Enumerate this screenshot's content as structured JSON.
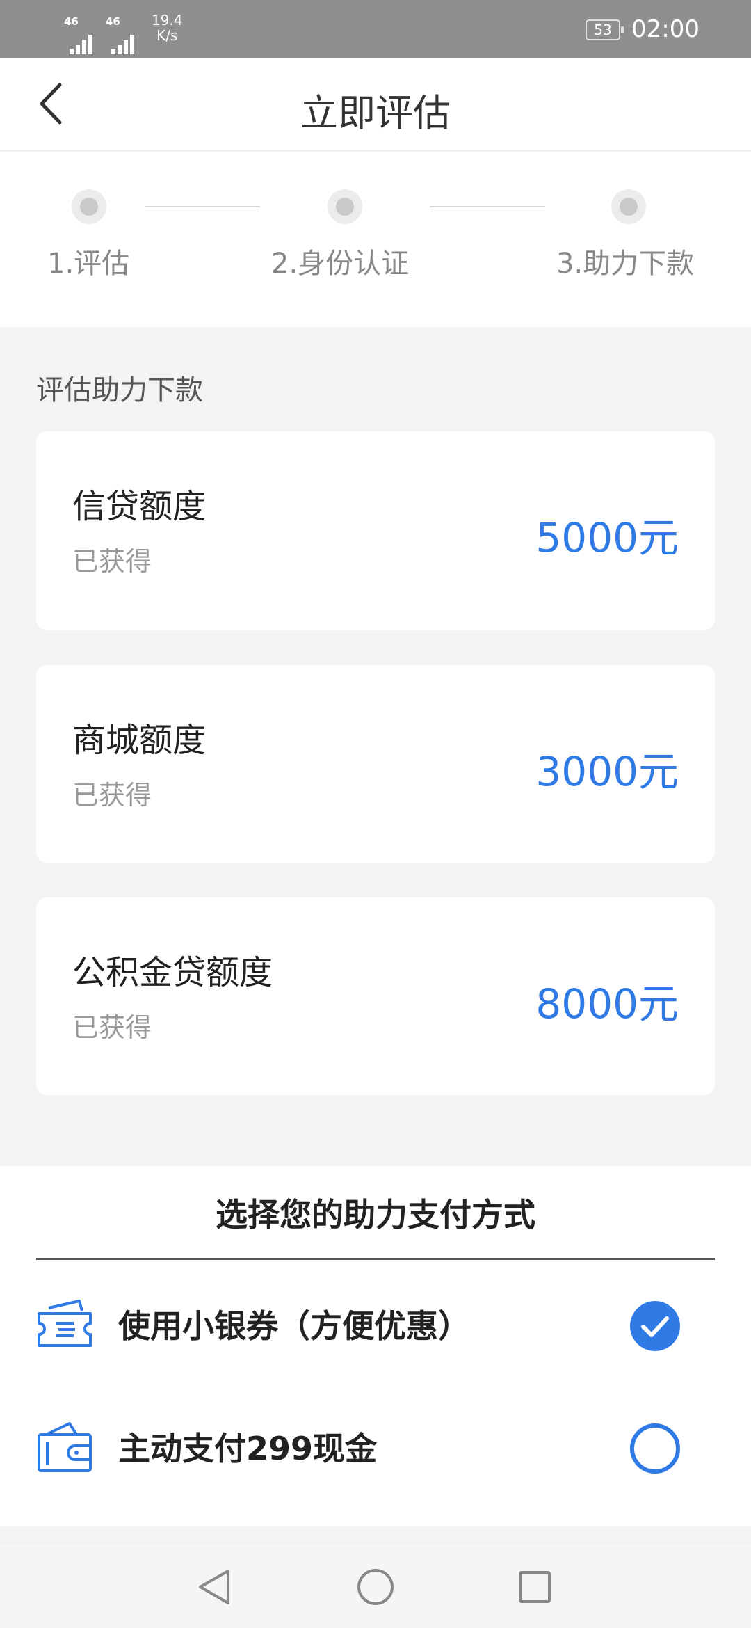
{
  "status_bar": {
    "net1": "46",
    "net2": "46",
    "speed_value": "19.4",
    "speed_unit": "K/s",
    "battery": "53",
    "time": "02:00"
  },
  "header": {
    "title": "立即评估"
  },
  "steps": [
    {
      "label": "1.评估"
    },
    {
      "label": "2.身份认证"
    },
    {
      "label": "3.助力下款"
    }
  ],
  "section_title": "评估助力下款",
  "cards": [
    {
      "title": "信贷额度",
      "status": "已获得",
      "amount": "5000元"
    },
    {
      "title": "商城额度",
      "status": "已获得",
      "amount": "3000元"
    },
    {
      "title": "公积金贷额度",
      "status": "已获得",
      "amount": "8000元"
    }
  ],
  "payment": {
    "title": "选择您的助力支付方式",
    "options": [
      {
        "label": "使用小银券（方便优惠）",
        "selected": true,
        "icon": "ticket-icon"
      },
      {
        "label": "主动支付299现金",
        "selected": false,
        "icon": "wallet-icon"
      }
    ]
  },
  "colors": {
    "accent": "#2f7ae5",
    "statusbar": "#8f8f8f"
  }
}
